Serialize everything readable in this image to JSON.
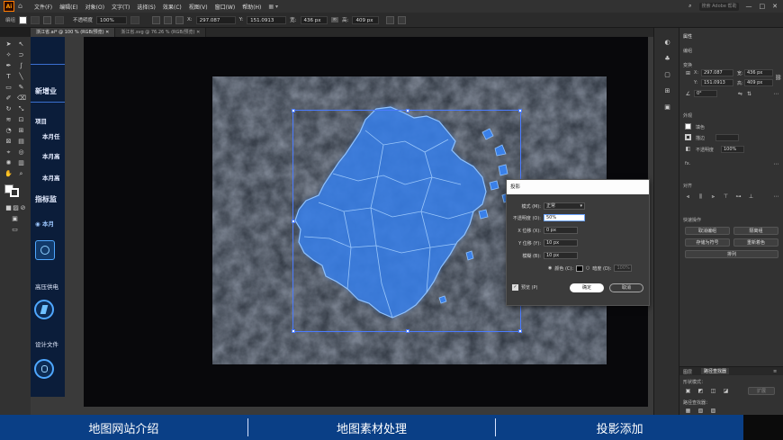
{
  "app": {
    "logo": "Ai",
    "menu": [
      "文件(F)",
      "编辑(E)",
      "对象(O)",
      "文字(T)",
      "选择(S)",
      "效果(C)",
      "视图(V)",
      "窗口(W)",
      "帮助(H)"
    ],
    "search_placeholder": "搜索 Adobe 帮助",
    "window_controls": [
      "—",
      "□",
      "✕"
    ]
  },
  "control_bar": {
    "opacity_label": "不透明度",
    "opacity_value": "100%",
    "x_label": "X:",
    "x_value": "297.087",
    "y_label": "Y:",
    "y_value": "151.0913",
    "w_label": "宽:",
    "w_value": "436 px",
    "h_label": "高:",
    "h_value": "409 px"
  },
  "tabs": [
    {
      "label": "浙江省.ai* @ 100 % (RGB/预览)"
    },
    {
      "label": "浙江省.svg @ 76.26 % (RGB/预览)"
    }
  ],
  "design": {
    "title": "新增业",
    "item_project": "项目",
    "item_month1": "本月任",
    "item_month2": "本月高",
    "item_month3": "本月高",
    "section_indicator": "指标监",
    "item_month4": "本月",
    "label_hv": "高压供电",
    "label_design": "设计文件"
  },
  "dialog": {
    "title": "投影",
    "mode_label": "模式 (M):",
    "mode_value": "正常",
    "opacity_label": "不透明度 (O):",
    "opacity_value": "50%",
    "x_label": "X 位移 (X):",
    "x_value": "0 px",
    "y_label": "Y 位移 (Y):",
    "y_value": "10 px",
    "blur_label": "模糊 (B):",
    "blur_value": "10 px",
    "color_label": "颜色 (C):",
    "darkness_label": "暗度 (D):",
    "darkness_value": "100%",
    "preview_label": "预览 (P)",
    "ok_label": "确定",
    "cancel_label": "取消"
  },
  "props_panel": {
    "tab": "属性",
    "section_group": "编组",
    "section_transform": "变换",
    "x_label": "X:",
    "x_value": "297.087",
    "y_label": "Y:",
    "y_value": "151.0913",
    "w_label": "宽:",
    "w_value": "436 px",
    "h_label": "高:",
    "h_value": "409 px",
    "angle_value": "0°",
    "section_appearance": "外观",
    "fill_label": "填色",
    "stroke_label": "描边",
    "opacity_label": "不透明度",
    "opacity_value": "100%",
    "fx_label": "fx.",
    "section_align": "对齐",
    "section_quick": "快速操作",
    "btn_ungroup": "取消编组",
    "btn_isolate": "隔离组",
    "btn_save_symbol": "存储为符号",
    "btn_recolor": "重新着色",
    "btn_arrange": "排列",
    "bottom_tab1": "图层",
    "bottom_tab2": "路径查找器",
    "shape_mode_label": "形状模式：",
    "expand_label": "扩展",
    "pathfinder_label": "路径查找器："
  },
  "caption": {
    "items": [
      "地图网站介绍",
      "地图素材处理",
      "投影添加"
    ]
  },
  "colors": {
    "map_fill": "#2f6fd6",
    "map_edge": "#7fb4ff",
    "caption_bg": "#0a3f86"
  }
}
